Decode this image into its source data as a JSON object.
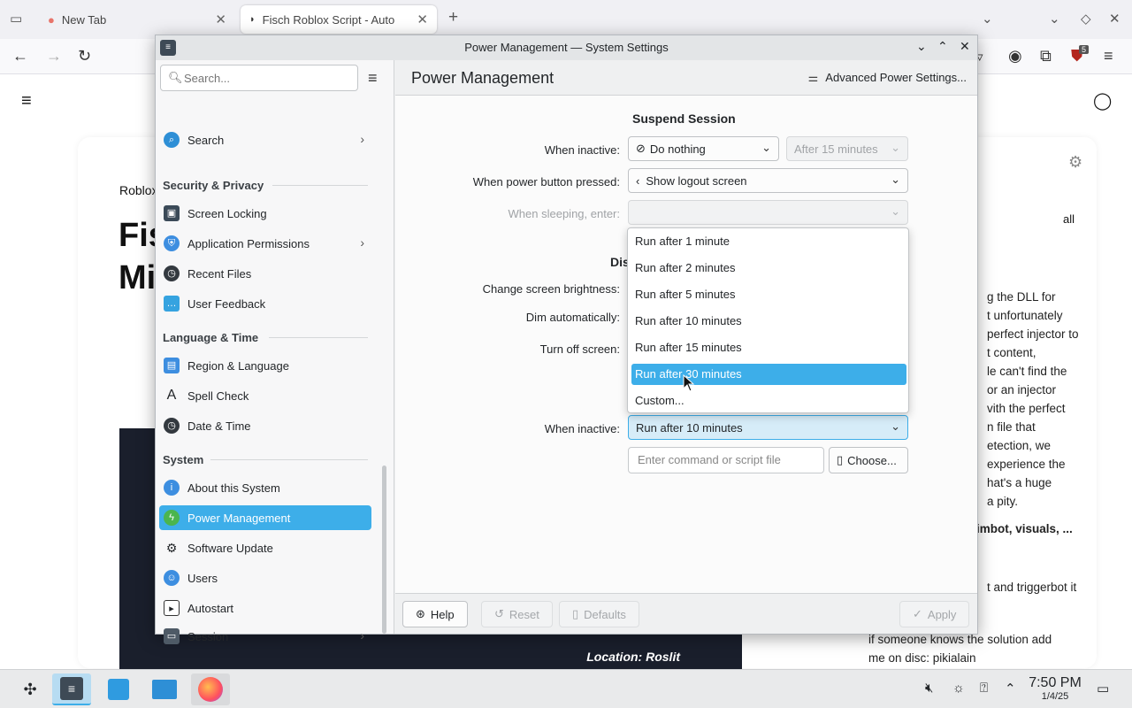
{
  "browser": {
    "tabs": [
      {
        "label": "New Tab",
        "active": false
      },
      {
        "label": "Fisch Roblox Script - Auto",
        "active": true
      }
    ],
    "new_tab_symbol": "+",
    "extension_badge": "5"
  },
  "webpage": {
    "breadcrumb": "Roblox",
    "title_line1": "Fis",
    "title_line2": "Mi",
    "filter_all": "all",
    "video_location": "Location: Roslit",
    "article_lines": [
      "g the DLL for",
      "t unfortunately",
      "perfect injector to",
      "t content,",
      "le can't find the",
      " or an injector",
      "vith the perfect",
      "n file that",
      "etection, we",
      "experience the",
      "hat's a huge",
      "a pity."
    ],
    "bold_line": "imbot, visuals, ...",
    "line_trigger": "t and triggerbot it",
    "comment_line1": "if someone knows the solution add",
    "comment_line2": "me on disc: pikialain"
  },
  "window": {
    "title": "Power Management — System Settings",
    "search_placeholder": "Search...",
    "page_title": "Power Management",
    "advanced_button": "Advanced Power Settings..."
  },
  "sidebar": {
    "items_top": [
      {
        "label": "Search",
        "chevron": true
      }
    ],
    "section_security": "Security & Privacy",
    "items_security": [
      {
        "label": "Screen Locking",
        "chevron": false
      },
      {
        "label": "Application Permissions",
        "chevron": true
      },
      {
        "label": "Recent Files",
        "chevron": false
      },
      {
        "label": "User Feedback",
        "chevron": false
      }
    ],
    "section_language": "Language & Time",
    "items_language": [
      {
        "label": "Region & Language"
      },
      {
        "label": "Spell Check"
      },
      {
        "label": "Date & Time"
      }
    ],
    "section_system": "System",
    "items_system": [
      {
        "label": "About this System",
        "chevron": false
      },
      {
        "label": "Power Management",
        "chevron": false,
        "active": true
      },
      {
        "label": "Software Update",
        "chevron": false
      },
      {
        "label": "Users",
        "chevron": false
      },
      {
        "label": "Autostart",
        "chevron": false
      },
      {
        "label": "Session",
        "chevron": true
      }
    ]
  },
  "content": {
    "suspend_heading": "Suspend Session",
    "when_inactive_label": "When inactive:",
    "when_inactive_value": "Do nothing",
    "after_value": "After 15 minutes",
    "power_button_label": "When power button pressed:",
    "power_button_value": "Show logout screen",
    "sleeping_label": "When sleeping, enter:",
    "sleeping_value": "",
    "display_heading_partial": "Dis",
    "brightness_label": "Change screen brightness:",
    "dim_label": "Dim automatically:",
    "turn_off_label": "Turn off screen:",
    "run_script_inactive_label": "When inactive:",
    "run_script_value": "Run after 10 minutes",
    "script_placeholder": "Enter command or script file",
    "choose_button": "Choose..."
  },
  "popup": {
    "options": [
      "Run after 1 minute",
      "Run after 2 minutes",
      "Run after 5 minutes",
      "Run after 10 minutes",
      "Run after 15 minutes",
      "Run after 30 minutes",
      "Custom..."
    ],
    "selected_index": 5
  },
  "footer": {
    "help": "Help",
    "reset": "Reset",
    "defaults": "Defaults",
    "apply": "Apply"
  },
  "taskbar": {
    "time": "7:50 PM",
    "date": "1/4/25"
  },
  "colors": {
    "accent": "#3daee9",
    "window_bg": "#eff0f1",
    "text": "#232629"
  }
}
